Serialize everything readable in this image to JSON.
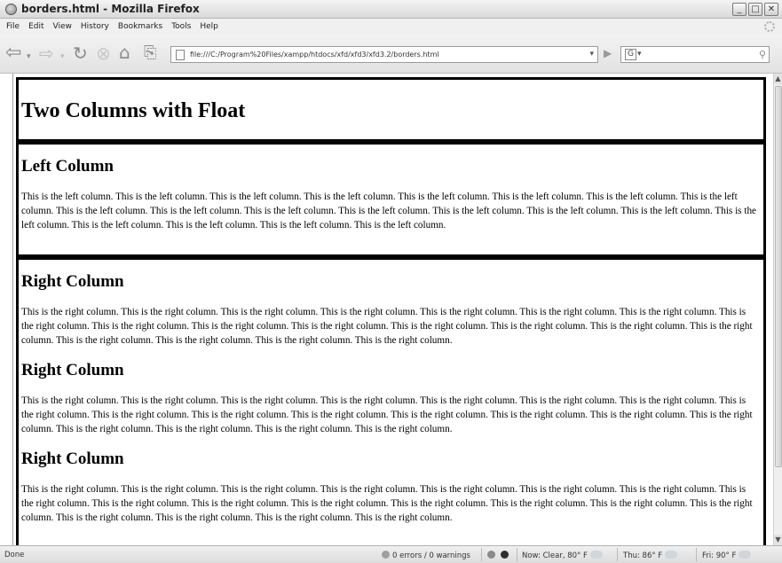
{
  "window": {
    "title": "borders.html - Mozilla Firefox",
    "controls": [
      "_",
      "□",
      "✕"
    ]
  },
  "menu": [
    "File",
    "Edit",
    "View",
    "History",
    "Bookmarks",
    "Tools",
    "Help"
  ],
  "toolbar": {
    "url": "file:///C:/Program%20Files/xampp/htdocs/xfd/xfd3/xfd3.2/borders.html",
    "search_engine": "G"
  },
  "page": {
    "header": "Two Columns with Float",
    "left": {
      "heading": "Left Column",
      "text": "This is the left column. This is the left column. This is the left column. This is the left column. This is the left column. This is the left column. This is the left column. This is the left column. This is the left column. This is the left column. This is the left column. This is the left column. This is the left column. This is the left column. This is the left column. This is the left column. This is the left column. This is the left column. This is the left column. This is the left column."
    },
    "right": [
      {
        "heading": "Right Column",
        "text": "This is the right column. This is the right column. This is the right column. This is the right column. This is the right column. This is the right column. This is the right column. This is the right column. This is the right column. This is the right column. This is the right column. This is the right column. This is the right column. This is the right column. This is the right column. This is the right column. This is the right column. This is the right column. This is the right column."
      },
      {
        "heading": "Right Column",
        "text": "This is the right column. This is the right column. This is the right column. This is the right column. This is the right column. This is the right column. This is the right column. This is the right column. This is the right column. This is the right column. This is the right column. This is the right column. This is the right column. This is the right column. This is the right column. This is the right column. This is the right column. This is the right column. This is the right column."
      },
      {
        "heading": "Right Column",
        "text": "This is the right column. This is the right column. This is the right column. This is the right column. This is the right column. This is the right column. This is the right column. This is the right column. This is the right column. This is the right column. This is the right column. This is the right column. This is the right column. This is the right column. This is the right column. This is the right column. This is the right column. This is the right column. This is the right column."
      }
    ]
  },
  "status": {
    "done": "Done",
    "errors": "0 errors / 0 warnings",
    "now": "Now: Clear, 80° F",
    "thu": "Thu: 86° F",
    "fri": "Fri: 90° F"
  }
}
